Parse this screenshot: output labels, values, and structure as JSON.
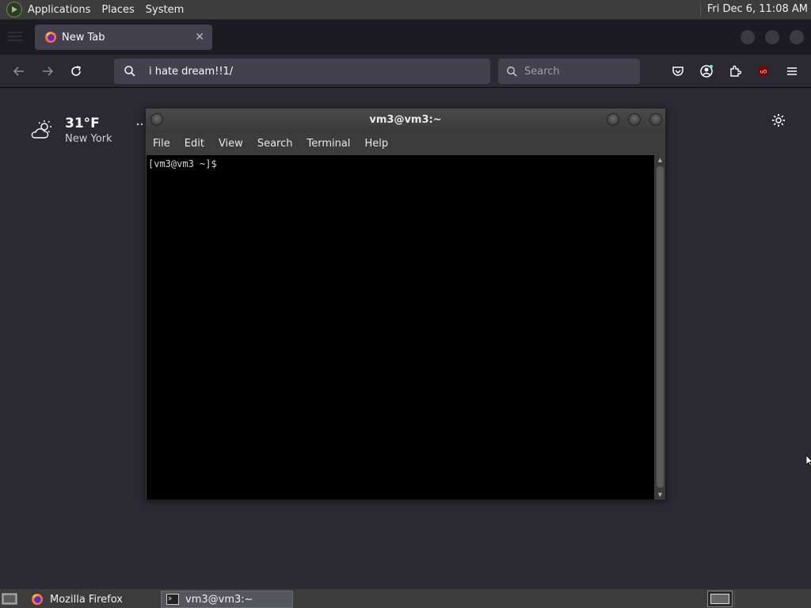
{
  "top_panel": {
    "menus": [
      "Applications",
      "Places",
      "System"
    ],
    "clock": "Fri Dec  6, 11:08 AM"
  },
  "browser": {
    "tab_title": "New Tab",
    "url": "i hate dream!!1/",
    "search_placeholder": "Search",
    "accent": "#42414d"
  },
  "newtab": {
    "temperature": "31°F",
    "city": "New York"
  },
  "terminal": {
    "title": "vm3@vm3:~",
    "menu": [
      "File",
      "Edit",
      "View",
      "Search",
      "Terminal",
      "Help"
    ],
    "prompt": "[vm3@vm3 ~]$ "
  },
  "taskbar": {
    "items": [
      {
        "label": "Mozilla Firefox",
        "icon": "firefox-icon"
      },
      {
        "label": "vm3@vm3:~",
        "icon": "terminal-icon"
      }
    ]
  }
}
